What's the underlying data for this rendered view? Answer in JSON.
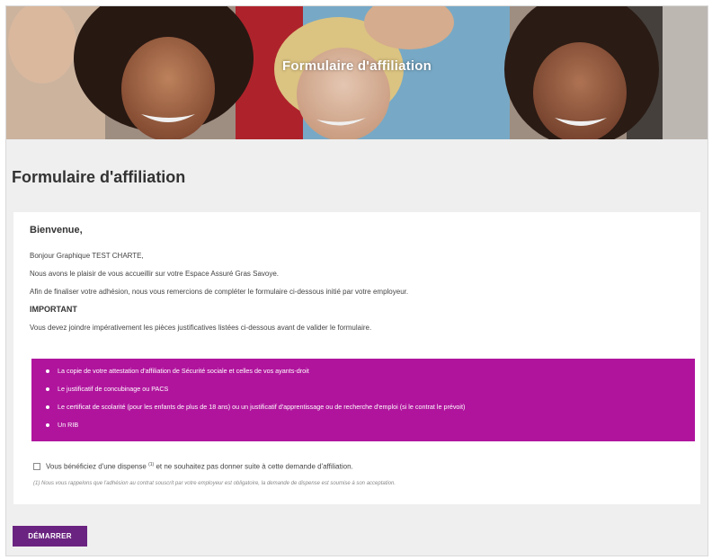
{
  "banner": {
    "title": "Formulaire d'affiliation"
  },
  "page": {
    "title": "Formulaire d'affiliation"
  },
  "welcome": {
    "heading": "Bienvenue,",
    "greeting": "Bonjour Graphique TEST CHARTE,",
    "line1": "Nous avons le plaisir de vous accueillir sur votre Espace Assuré Gras Savoye.",
    "line2": "Afin de finaliser votre adhésion, nous vous remercions de compléter le formulaire ci-dessous initié par votre employeur.",
    "important_label": "IMPORTANT",
    "line3": "Vous devez joindre impérativement les pièces justificatives listées ci-dessous avant de valider le formulaire."
  },
  "documents": [
    "La copie de votre attestation d'affiliation de Sécurité sociale et celles de vos ayants-droit",
    "Le justificatif de concubinage ou PACS",
    "Le certificat de scolarité (pour les enfants de plus de 18 ans) ou un justificatif d'apprentissage ou de recherche d'emploi (si le contrat le prévoit)",
    "Un RIB"
  ],
  "waiver": {
    "text_before": "Vous bénéficiez d'une dispense",
    "footnote_marker": "(1)",
    "text_after": "et ne souhaitez pas donner suite à cette demande d'affiliation.",
    "checked": false,
    "footnote": "(1) Nous vous rappelons que l'adhésion au contrat souscrit par votre employeur est obligatoire, la demande de dispense est soumise à son acceptation."
  },
  "actions": {
    "start_label": "DÉMARRER"
  },
  "colors": {
    "accent_magenta": "#b0149d",
    "button_purple": "#6a2380",
    "page_background": "#efefef"
  }
}
